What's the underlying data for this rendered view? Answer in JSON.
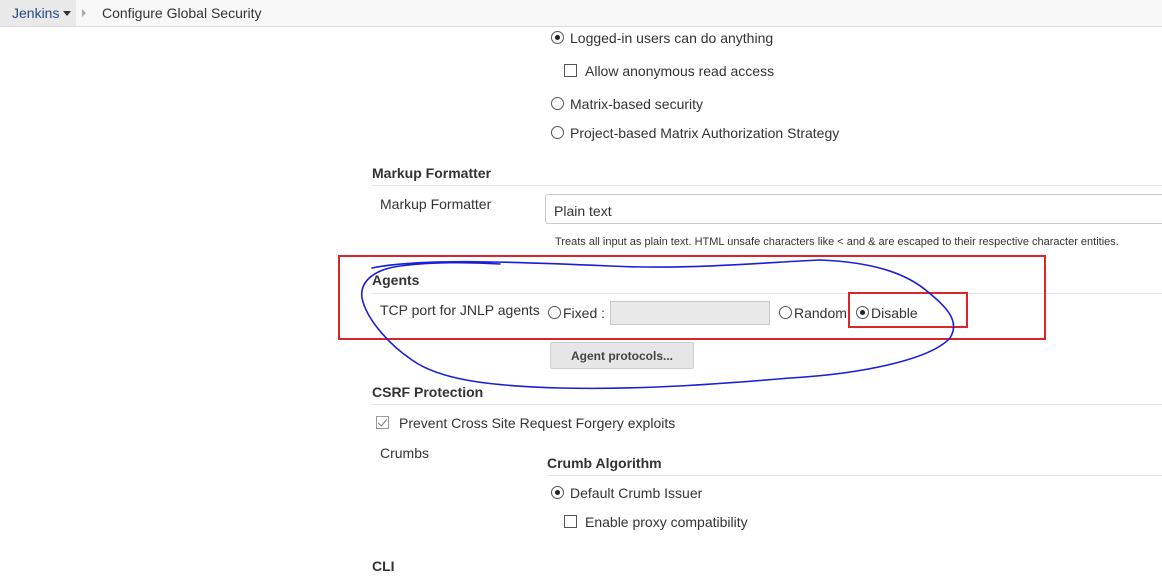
{
  "breadcrumb": {
    "root": "Jenkins",
    "page": "Configure Global Security"
  },
  "authorization": {
    "options": [
      {
        "label": "Logged-in users can do anything",
        "selected": true
      },
      {
        "label": "Matrix-based security",
        "selected": false
      },
      {
        "label": "Project-based Matrix Authorization Strategy",
        "selected": false
      }
    ],
    "anonymous_read": {
      "label": "Allow anonymous read access",
      "checked": false
    }
  },
  "markup_formatter": {
    "section_title": "Markup Formatter",
    "field_label": "Markup Formatter",
    "selected_value": "Plain text",
    "description": "Treats all input as plain text. HTML unsafe characters like < and & are escaped to their respective character entities."
  },
  "agents": {
    "section_title": "Agents",
    "field_label": "TCP port for JNLP agents",
    "fixed_label": "Fixed :",
    "fixed_value": "",
    "random_label": "Random",
    "disable_label": "Disable",
    "selected": "Disable",
    "protocols_button": "Agent protocols..."
  },
  "csrf": {
    "section_title": "CSRF Protection",
    "prevent_label": "Prevent Cross Site Request Forgery exploits",
    "prevent_checked": true,
    "crumbs_label": "Crumbs",
    "crumb_algorithm_title": "Crumb Algorithm",
    "default_issuer_label": "Default Crumb Issuer",
    "default_issuer_selected": true,
    "proxy_compat_label": "Enable proxy compatibility",
    "proxy_compat_checked": false
  },
  "cli": {
    "section_title": "CLI"
  },
  "annotation_colors": {
    "box": "#d9262c",
    "ink": "#1a1fd6"
  }
}
